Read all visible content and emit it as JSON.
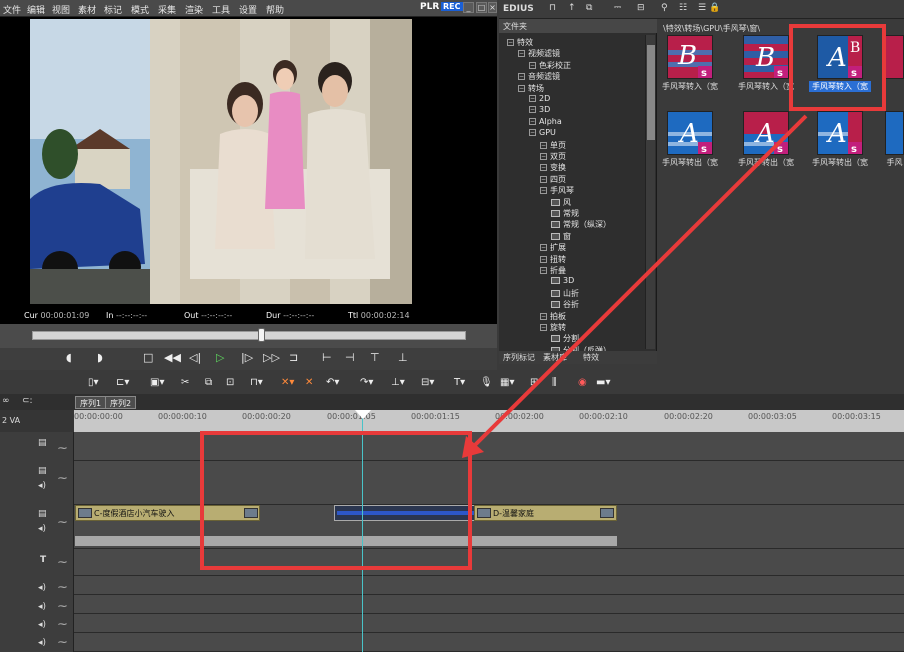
{
  "menu": [
    "文件",
    "编辑",
    "视图",
    "素材",
    "标记",
    "模式",
    "采集",
    "渲染",
    "工具",
    "设置",
    "帮助"
  ],
  "player": {
    "plr": "PLR",
    "rec": "REC",
    "cur_label": "Cur",
    "cur_value": "00:00:01:09",
    "in_label": "In",
    "in_value": "--:--:--:--",
    "out_label": "Out",
    "out_value": "--:--:--:--",
    "dur_label": "Dur",
    "dur_value": "--:--:--:--",
    "ttl_label": "Ttl",
    "ttl_value": "00:00:02:14"
  },
  "edius_title": "EDIUS",
  "tree": {
    "header": "文件夹",
    "items": [
      {
        "label": "特效",
        "indent": 0
      },
      {
        "label": "视频滤镜",
        "indent": 1
      },
      {
        "label": "色彩校正",
        "indent": 2
      },
      {
        "label": "音频滤镜",
        "indent": 1
      },
      {
        "label": "转场",
        "indent": 1
      },
      {
        "label": "2D",
        "indent": 2
      },
      {
        "label": "3D",
        "indent": 2
      },
      {
        "label": "Alpha",
        "indent": 2
      },
      {
        "label": "GPU",
        "indent": 2
      },
      {
        "label": "单页",
        "indent": 3
      },
      {
        "label": "双页",
        "indent": 3
      },
      {
        "label": "变换",
        "indent": 3
      },
      {
        "label": "四页",
        "indent": 3
      },
      {
        "label": "手风琴",
        "indent": 3
      },
      {
        "label": "风",
        "indent": 4
      },
      {
        "label": "常规",
        "indent": 4
      },
      {
        "label": "常规（纵深）",
        "indent": 4
      },
      {
        "label": "窗",
        "indent": 4
      },
      {
        "label": "扩展",
        "indent": 3
      },
      {
        "label": "扭转",
        "indent": 3
      },
      {
        "label": "折叠",
        "indent": 3
      },
      {
        "label": "3D",
        "indent": 4
      },
      {
        "label": "山折",
        "indent": 4
      },
      {
        "label": "谷折",
        "indent": 4
      },
      {
        "label": "拍板",
        "indent": 3
      },
      {
        "label": "旋转",
        "indent": 3
      },
      {
        "label": "分割",
        "indent": 4
      },
      {
        "label": "分割（反弹）",
        "indent": 4
      }
    ]
  },
  "bottom_tabs": [
    "序列标记",
    "素材库",
    "特效"
  ],
  "grid": {
    "path": "\\特效\\转场\\GPU\\手风琴\\窗\\",
    "items": [
      {
        "caption": "手风琴转入（宽",
        "letters": "B",
        "selected": false
      },
      {
        "caption": "手风琴转入（宽",
        "letters": "B",
        "selected": false
      },
      {
        "caption": "手风琴转入（宽",
        "letters": "A",
        "selected": true
      },
      {
        "caption": "",
        "letters": "",
        "selected": false
      },
      {
        "caption": "手风琴转出（宽",
        "letters": "A",
        "selected": false
      },
      {
        "caption": "手风琴转出（宽",
        "letters": "A",
        "selected": false
      },
      {
        "caption": "手风琴转出（宽",
        "letters": "A",
        "selected": false
      },
      {
        "caption": "手风",
        "letters": "",
        "selected": false
      }
    ]
  },
  "seq_tabs": [
    "序列1",
    "序列2"
  ],
  "ruler_ticks": [
    "00:00:00:00",
    "00:00:00:10",
    "00:00:00:20",
    "00:00:01:05",
    "00:00:01:15",
    "00:00:02:00",
    "00:00:02:10",
    "00:00:02:20",
    "00:00:03:05",
    "00:00:03:15"
  ],
  "clips": {
    "clip1": "C-度假酒店小汽车驶入",
    "clip2": "D-温馨家庭"
  },
  "track_header_label": "2 VA"
}
